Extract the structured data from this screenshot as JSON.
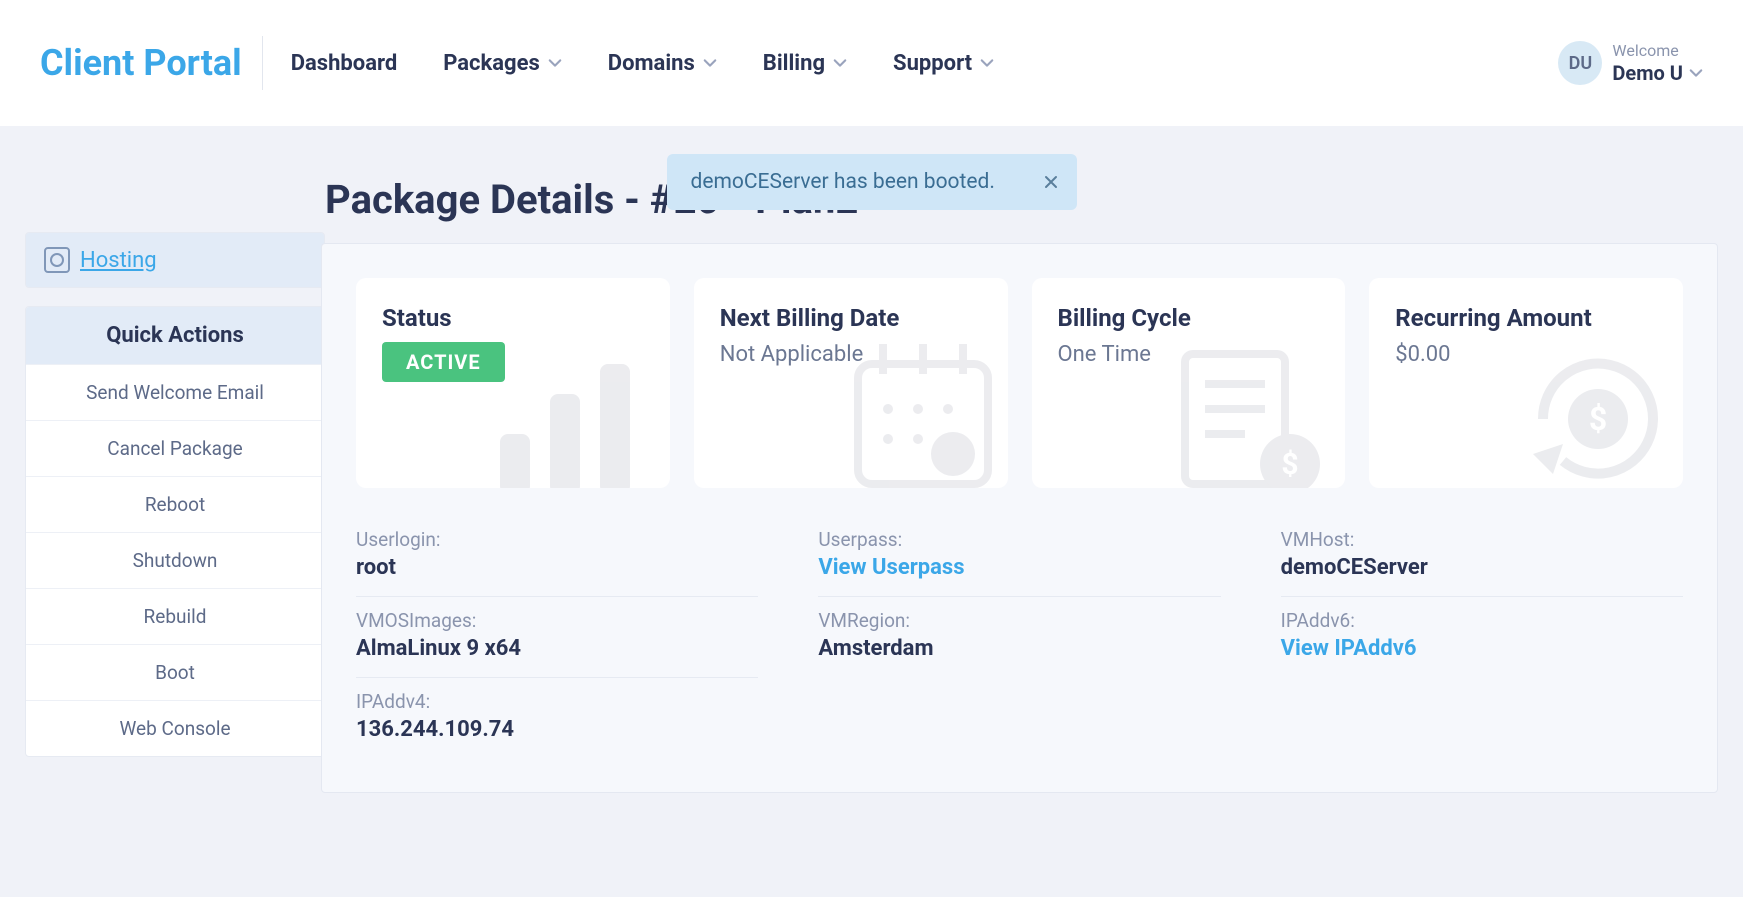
{
  "brand": "Client Portal",
  "nav": {
    "dashboard": "Dashboard",
    "packages": "Packages",
    "domains": "Domains",
    "billing": "Billing",
    "support": "Support"
  },
  "user": {
    "initials": "DU",
    "welcome": "Welcome",
    "name": "Demo U"
  },
  "toast": {
    "message": "demoCEServer has been booted."
  },
  "sidebar": {
    "hosting": "Hosting",
    "quick_actions_title": "Quick Actions",
    "actions": {
      "welcome_email": "Send Welcome Email",
      "cancel_package": "Cancel Package",
      "reboot": "Reboot",
      "shutdown": "Shutdown",
      "rebuild": "Rebuild",
      "boot": "Boot",
      "web_console": "Web Console"
    }
  },
  "page": {
    "title": "Package Details - #20 - Plan2"
  },
  "cards": {
    "status": {
      "title": "Status",
      "badge": "ACTIVE"
    },
    "next_billing": {
      "title": "Next Billing Date",
      "value": "Not Applicable"
    },
    "cycle": {
      "title": "Billing Cycle",
      "value": "One Time"
    },
    "recurring": {
      "title": "Recurring Amount",
      "value": "$0.00"
    }
  },
  "details": {
    "col1": {
      "userlogin_label": "Userlogin:",
      "userlogin_value": "root",
      "vmos_label": "VMOSImages:",
      "vmos_value": "AlmaLinux 9 x64",
      "ipv4_label": "IPAddv4:",
      "ipv4_value": "136.244.109.74"
    },
    "col2": {
      "userpass_label": "Userpass:",
      "userpass_link": "View Userpass",
      "vmregion_label": "VMRegion:",
      "vmregion_value": "Amsterdam"
    },
    "col3": {
      "vmhost_label": "VMHost:",
      "vmhost_value": "demoCEServer",
      "ipv6_label": "IPAddv6:",
      "ipv6_link": "View IPAddv6"
    }
  }
}
